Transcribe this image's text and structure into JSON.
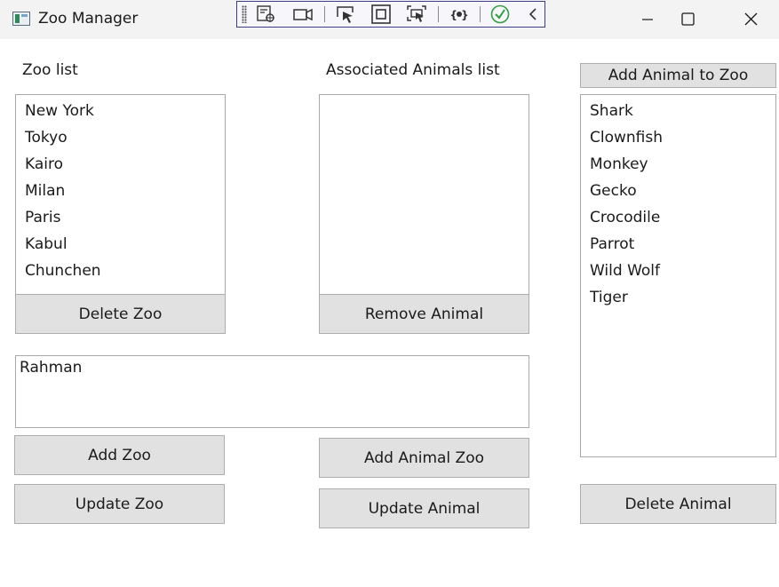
{
  "window": {
    "title": "Zoo Manager",
    "controls": [
      "minimize-icon",
      "maximize-icon",
      "close-icon"
    ]
  },
  "debug_toolbar": {
    "icons": [
      "grip-icon",
      "live-visual-tree-icon",
      "camera-icon",
      "select-element-icon",
      "display-layout-adorners-icon",
      "track-focus-icon",
      "binding-failures-icon",
      "checkmark-icon",
      "collapse-chevron-icon"
    ],
    "accent": "#3c3c8c",
    "check_color": "#2e9e3e"
  },
  "zoo_panel": {
    "label": "Zoo list",
    "items": [
      "New York",
      "Tokyo",
      "Kairo",
      "Milan",
      "Paris",
      "Kabul",
      "Chunchen"
    ],
    "delete_button": "Delete Zoo"
  },
  "associated_panel": {
    "label": "Associated Animals list",
    "items": [],
    "remove_button": "Remove Animal"
  },
  "animal_panel": {
    "add_to_zoo_button": "Add Animal to Zoo",
    "items": [
      "Shark",
      "Clownfish",
      "Monkey",
      "Gecko",
      "Crocodile",
      "Parrot",
      "Wild Wolf",
      "Tiger"
    ],
    "delete_button": "Delete Animal"
  },
  "input": {
    "value": "Rahman"
  },
  "actions": {
    "add_zoo": "Add Zoo",
    "update_zoo": "Update Zoo",
    "add_animal_zoo": "Add Animal Zoo",
    "update_animal": "Update Animal"
  }
}
